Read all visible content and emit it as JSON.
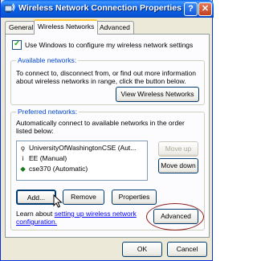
{
  "window": {
    "title": "Wireless Network Connection Properties",
    "help_glyph": "?",
    "close_glyph": "✕"
  },
  "tabs": [
    {
      "label": "General"
    },
    {
      "label": "Wireless Networks"
    },
    {
      "label": "Advanced"
    }
  ],
  "use_windows_checkbox": {
    "label": "Use Windows to configure my wireless network settings",
    "checked": true
  },
  "available": {
    "title": "Available networks:",
    "description": "To connect to, disconnect from, or find out more information about wireless networks in range, click the button below.",
    "view_button": "View Wireless Networks"
  },
  "preferred": {
    "title": "Preferred networks:",
    "description": "Automatically connect to available networks in the order listed below:",
    "networks": [
      {
        "name": "UniversityOfWashingtonCSE (Aut...",
        "icon": "antenna-icon"
      },
      {
        "name": "EE (Manual)",
        "icon": "antenna-icon"
      },
      {
        "name": "cse370 (Automatic)",
        "icon": "wireless-icon"
      }
    ],
    "move_up": "Move up",
    "move_down": "Move down",
    "add": "Add...",
    "remove": "Remove",
    "properties": "Properties"
  },
  "learn": {
    "prefix": "Learn about ",
    "link_line1": "setting up wireless network",
    "link_line2": "configuration."
  },
  "advanced_button": "Advanced",
  "ok_button": "OK",
  "cancel_button": "Cancel",
  "colors": {
    "title_bar": "#0a5ee8",
    "group_title": "#0046d5",
    "annotation": "#8b1a1a"
  }
}
